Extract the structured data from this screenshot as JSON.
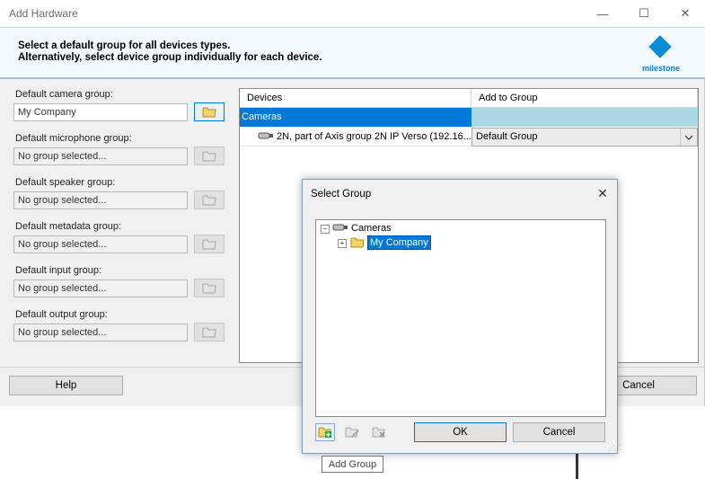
{
  "window": {
    "title": "Add Hardware",
    "minimize": "—",
    "maximize": "☐",
    "close": "✕"
  },
  "banner": {
    "line1": "Select a default group for all devices types.",
    "line2": "Alternatively, select device group individually for each device.",
    "logo_text": "milestone"
  },
  "groups": [
    {
      "label": "Default camera group:",
      "value": "My Company"
    },
    {
      "label": "Default microphone group:",
      "value": "No group selected..."
    },
    {
      "label": "Default speaker group:",
      "value": "No group selected..."
    },
    {
      "label": "Default metadata group:",
      "value": "No group selected..."
    },
    {
      "label": "Default input group:",
      "value": "No group selected..."
    },
    {
      "label": "Default output group:",
      "value": "No group selected..."
    }
  ],
  "grid": {
    "columns": [
      "Devices",
      "Add to Group"
    ],
    "category": "Cameras",
    "device": "2N, part of Axis group 2N IP Verso (192.16...",
    "group_value": "Default Group"
  },
  "footer": {
    "help": "Help",
    "cancel": "Cancel"
  },
  "dialog": {
    "title": "Select Group",
    "close": "✕",
    "tree_root": "Cameras",
    "tree_child": "My Company",
    "ok": "OK",
    "cancel": "Cancel"
  },
  "tooltip": "Add Group",
  "colors": {
    "accent": "#0078d7",
    "brand": "#0a8bd6",
    "selection_light": "#add8e6",
    "folder": "#f7d46a"
  }
}
